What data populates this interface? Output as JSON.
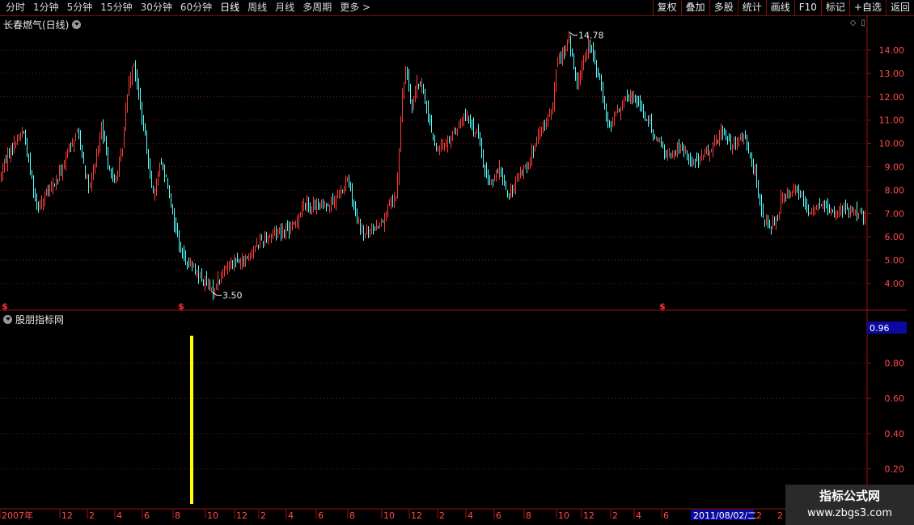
{
  "toolbar": {
    "periods": [
      "分时",
      "1分钟",
      "5分钟",
      "15分钟",
      "30分钟",
      "60分钟",
      "日线",
      "周线",
      "月线",
      "多周期",
      "更多 >"
    ],
    "active_period": "日线",
    "buttons": [
      "复权",
      "叠加",
      "多股",
      "统计",
      "画线",
      "F10",
      "标记",
      "+自选",
      "返回"
    ]
  },
  "chart": {
    "title": "长春燃气(日线)",
    "high_label": "14.78",
    "low_label": "3.50",
    "price_ticks": [
      "14.00",
      "13.00",
      "12.00",
      "11.00",
      "10.00",
      "9.00",
      "8.00",
      "7.00",
      "6.00",
      "5.00",
      "4.00"
    ],
    "marker_glyph": "$"
  },
  "indicator": {
    "title": "股朋指标网",
    "current_value": "0.96",
    "ticks": [
      "0.80",
      "0.60",
      "0.40",
      "0.20"
    ]
  },
  "time_axis": {
    "labels": [
      "2007年",
      "12",
      "2",
      "4",
      "6",
      "8",
      "10",
      "12",
      "2",
      "4",
      "6",
      "8",
      "10",
      "12",
      "2",
      "4",
      "6",
      "8",
      "10",
      "12",
      "2",
      "4",
      "6"
    ],
    "cursor_date": "2011/08/02/二",
    "after_cursor": [
      "2",
      "2"
    ]
  },
  "watermark": {
    "line1": "指标公式网",
    "line2": "www.zbgs3.com"
  },
  "colors": {
    "up": "#ff3b3b",
    "down": "#54ffff",
    "axis": "#a01010",
    "indicator_bar": "#ffff00",
    "cursor_bg": "#0a0aa0"
  },
  "chart_data": {
    "type": "candlestick",
    "ylim": [
      3.4,
      14.9
    ],
    "anchors": [
      [
        0,
        8.6
      ],
      [
        10,
        9.6
      ],
      [
        28,
        10.6
      ],
      [
        45,
        7.3
      ],
      [
        70,
        8.4
      ],
      [
        95,
        10.6
      ],
      [
        110,
        7.9
      ],
      [
        125,
        10.6
      ],
      [
        140,
        8.2
      ],
      [
        150,
        9.5
      ],
      [
        158,
        12.6
      ],
      [
        165,
        13.5
      ],
      [
        172,
        11.8
      ],
      [
        180,
        10.0
      ],
      [
        190,
        7.6
      ],
      [
        197,
        9.2
      ],
      [
        205,
        8.6
      ],
      [
        215,
        6.6
      ],
      [
        225,
        5.2
      ],
      [
        240,
        4.6
      ],
      [
        255,
        4.0
      ],
      [
        262,
        3.6
      ],
      [
        270,
        4.2
      ],
      [
        285,
        5.0
      ],
      [
        300,
        4.9
      ],
      [
        320,
        5.8
      ],
      [
        340,
        6.2
      ],
      [
        360,
        6.3
      ],
      [
        375,
        7.4
      ],
      [
        395,
        7.3
      ],
      [
        415,
        7.6
      ],
      [
        430,
        8.5
      ],
      [
        440,
        6.7
      ],
      [
        450,
        6.1
      ],
      [
        470,
        6.6
      ],
      [
        490,
        7.8
      ],
      [
        497,
        12.2
      ],
      [
        502,
        13.2
      ],
      [
        508,
        11.6
      ],
      [
        515,
        12.6
      ],
      [
        522,
        12.3
      ],
      [
        530,
        11.0
      ],
      [
        540,
        9.6
      ],
      [
        555,
        10.2
      ],
      [
        565,
        10.7
      ],
      [
        575,
        11.2
      ],
      [
        590,
        10.4
      ],
      [
        600,
        8.6
      ],
      [
        608,
        8.4
      ],
      [
        618,
        8.9
      ],
      [
        628,
        7.7
      ],
      [
        640,
        8.5
      ],
      [
        655,
        9.4
      ],
      [
        670,
        10.6
      ],
      [
        683,
        11.5
      ],
      [
        688,
        13.6
      ],
      [
        697,
        13.9
      ],
      [
        703,
        14.5
      ],
      [
        712,
        12.5
      ],
      [
        720,
        13.5
      ],
      [
        728,
        14.3
      ],
      [
        740,
        12.9
      ],
      [
        752,
        10.6
      ],
      [
        768,
        11.7
      ],
      [
        785,
        12.1
      ],
      [
        798,
        11.1
      ],
      [
        812,
        10.2
      ],
      [
        826,
        9.4
      ],
      [
        840,
        9.8
      ],
      [
        858,
        9.2
      ],
      [
        875,
        9.6
      ],
      [
        893,
        10.6
      ],
      [
        905,
        9.8
      ],
      [
        920,
        10.3
      ],
      [
        933,
        8.8
      ],
      [
        940,
        7.2
      ],
      [
        950,
        6.3
      ],
      [
        963,
        7.0
      ],
      [
        965,
        7.7
      ],
      [
        978,
        8.1
      ],
      [
        990,
        7.8
      ],
      [
        1000,
        7.1
      ],
      [
        1015,
        7.4
      ],
      [
        1030,
        7.0
      ],
      [
        1045,
        7.2
      ],
      [
        1060,
        7.1
      ],
      [
        1068,
        6.8
      ]
    ],
    "indicator_bar": {
      "value": 0.96
    }
  }
}
